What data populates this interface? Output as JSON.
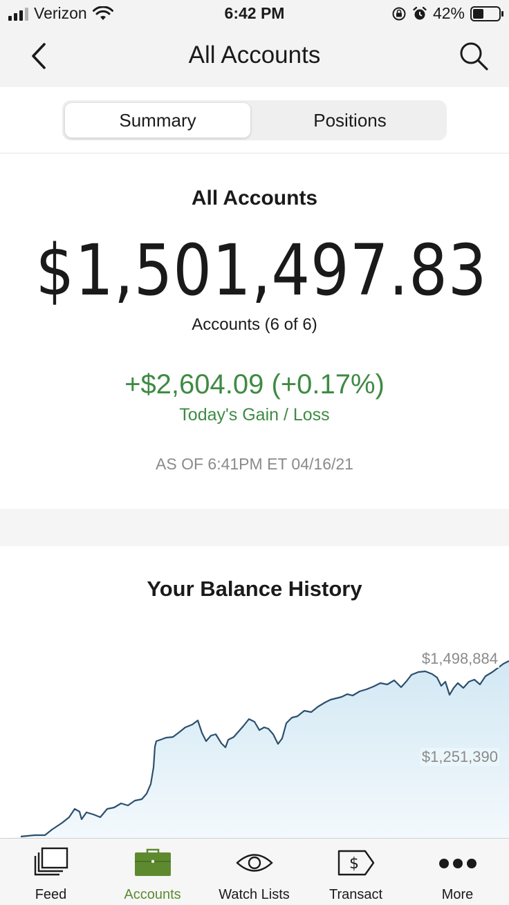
{
  "status_bar": {
    "carrier": "Verizon",
    "time": "6:42 PM",
    "battery": "42%"
  },
  "nav": {
    "title": "All Accounts"
  },
  "segments": {
    "summary": "Summary",
    "positions": "Positions",
    "selected": "Summary"
  },
  "summary": {
    "heading": "All Accounts",
    "balance": "$1,501,497.83",
    "accounts_count": "Accounts (6 of 6)",
    "gain": "+$2,604.09 (+0.17%)",
    "gain_label": "Today's Gain / Loss",
    "as_of": "AS OF 6:41PM ET 04/16/21"
  },
  "history": {
    "title": "Your Balance History",
    "label_high": "$1,498,884",
    "label_mid": "$1,251,390"
  },
  "colors": {
    "accent_green": "#3f8a44",
    "tab_active": "#5e8a2f",
    "chart_line": "#2b4f6e",
    "chart_fill": "#dcedf7"
  },
  "tabs": [
    {
      "label": "Feed",
      "icon": "feed-icon",
      "active": false
    },
    {
      "label": "Accounts",
      "icon": "briefcase-icon",
      "active": true
    },
    {
      "label": "Watch Lists",
      "icon": "eye-icon",
      "active": false
    },
    {
      "label": "Transact",
      "icon": "dollar-tag-icon",
      "active": false
    },
    {
      "label": "More",
      "icon": "more-dots-icon",
      "active": false
    }
  ]
}
